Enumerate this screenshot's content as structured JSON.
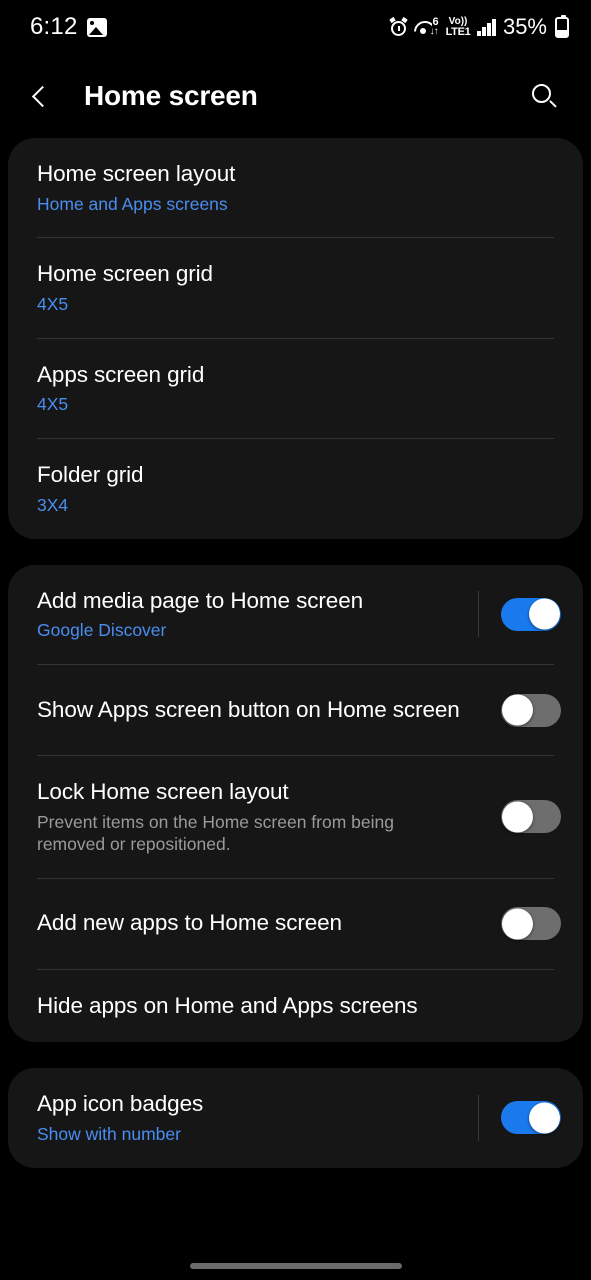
{
  "status_bar": {
    "time": "6:12",
    "photo_icon": "image-icon",
    "alarm_icon": "alarm-icon",
    "wifi_icon": "wifi-icon",
    "wifi_generation": "6",
    "wifi_arrows": "↓↑",
    "volte_top": "Vo))",
    "volte_bottom": "LTE1",
    "signal_icon": "signal-bars-icon",
    "battery_percent": "35%",
    "battery_icon": "battery-icon"
  },
  "app_bar": {
    "back_icon": "back-chevron-icon",
    "title": "Home screen",
    "search_icon": "search-icon"
  },
  "colors": {
    "page_background": "#000000",
    "card_background": "#161616",
    "accent_blue": "#4a8df0",
    "toggle_on": "#1a7aed",
    "toggle_off": "#6e6e6e",
    "divider": "#343434",
    "primary_text": "#ffffff",
    "secondary_text": "#9a9a9a"
  },
  "sections": [
    {
      "id": "layout-section",
      "rows": [
        {
          "name": "home-screen-layout",
          "title": "Home screen layout",
          "subtitle": "Home and Apps screens",
          "subtitle_style": "accent",
          "has_toggle": false
        },
        {
          "name": "home-screen-grid",
          "title": "Home screen grid",
          "subtitle": "4X5",
          "subtitle_style": "accent",
          "has_toggle": false
        },
        {
          "name": "apps-screen-grid",
          "title": "Apps screen grid",
          "subtitle": "4X5",
          "subtitle_style": "accent",
          "has_toggle": false
        },
        {
          "name": "folder-grid",
          "title": "Folder grid",
          "subtitle": "3X4",
          "subtitle_style": "accent",
          "has_toggle": false
        }
      ]
    },
    {
      "id": "behavior-section",
      "rows": [
        {
          "name": "add-media-page",
          "title": "Add media page to Home screen",
          "subtitle": "Google Discover",
          "subtitle_style": "accent",
          "has_toggle": true,
          "toggle_state": "on",
          "has_divider_bar": true
        },
        {
          "name": "show-apps-screen-button",
          "title": "Show Apps screen button on Home screen",
          "subtitle": "",
          "has_toggle": true,
          "toggle_state": "off",
          "has_divider_bar": false
        },
        {
          "name": "lock-home-screen-layout",
          "title": "Lock Home screen layout",
          "subtitle": "Prevent items on the Home screen from being removed or repositioned.",
          "subtitle_style": "muted",
          "has_toggle": true,
          "toggle_state": "off",
          "has_divider_bar": false
        },
        {
          "name": "add-new-apps",
          "title": "Add new apps to Home screen",
          "subtitle": "",
          "has_toggle": true,
          "toggle_state": "off",
          "has_divider_bar": false
        },
        {
          "name": "hide-apps",
          "title": "Hide apps on Home and Apps screens",
          "subtitle": "",
          "has_toggle": false
        }
      ]
    },
    {
      "id": "badges-section",
      "rows": [
        {
          "name": "app-icon-badges",
          "title": "App icon badges",
          "subtitle": "Show with number",
          "subtitle_style": "accent",
          "has_toggle": true,
          "toggle_state": "on",
          "has_divider_bar": true
        }
      ]
    }
  ],
  "nav_bar": {
    "gesture_pill": "gesture-home-pill"
  }
}
